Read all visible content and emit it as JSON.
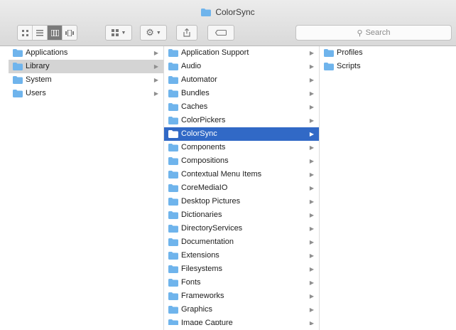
{
  "window": {
    "title": "ColorSync"
  },
  "toolbar": {
    "view_buttons": [
      "icon-view",
      "list-view",
      "column-view",
      "cover-flow-view"
    ],
    "search_placeholder": "Search"
  },
  "columns": [
    {
      "items": [
        {
          "label": "Applications",
          "has_arrow": true,
          "state": ""
        },
        {
          "label": "Library",
          "has_arrow": true,
          "state": "selected-inactive"
        },
        {
          "label": "System",
          "has_arrow": true,
          "state": ""
        },
        {
          "label": "Users",
          "has_arrow": true,
          "state": ""
        }
      ]
    },
    {
      "items": [
        {
          "label": "Application Support",
          "has_arrow": true,
          "state": ""
        },
        {
          "label": "Audio",
          "has_arrow": true,
          "state": ""
        },
        {
          "label": "Automator",
          "has_arrow": true,
          "state": ""
        },
        {
          "label": "Bundles",
          "has_arrow": true,
          "state": ""
        },
        {
          "label": "Caches",
          "has_arrow": true,
          "state": ""
        },
        {
          "label": "ColorPickers",
          "has_arrow": true,
          "state": ""
        },
        {
          "label": "ColorSync",
          "has_arrow": true,
          "state": "selected-active"
        },
        {
          "label": "Components",
          "has_arrow": true,
          "state": ""
        },
        {
          "label": "Compositions",
          "has_arrow": true,
          "state": ""
        },
        {
          "label": "Contextual Menu Items",
          "has_arrow": true,
          "state": ""
        },
        {
          "label": "CoreMediaIO",
          "has_arrow": true,
          "state": ""
        },
        {
          "label": "Desktop Pictures",
          "has_arrow": true,
          "state": ""
        },
        {
          "label": "Dictionaries",
          "has_arrow": true,
          "state": ""
        },
        {
          "label": "DirectoryServices",
          "has_arrow": true,
          "state": ""
        },
        {
          "label": "Documentation",
          "has_arrow": true,
          "state": ""
        },
        {
          "label": "Extensions",
          "has_arrow": true,
          "state": ""
        },
        {
          "label": "Filesystems",
          "has_arrow": true,
          "state": ""
        },
        {
          "label": "Fonts",
          "has_arrow": true,
          "state": ""
        },
        {
          "label": "Frameworks",
          "has_arrow": true,
          "state": ""
        },
        {
          "label": "Graphics",
          "has_arrow": true,
          "state": ""
        },
        {
          "label": "Image Capture",
          "has_arrow": true,
          "state": "partial"
        }
      ]
    },
    {
      "items": [
        {
          "label": "Profiles",
          "has_arrow": false,
          "state": ""
        },
        {
          "label": "Scripts",
          "has_arrow": false,
          "state": "",
          "icon": "scripts-folder-icon"
        }
      ]
    }
  ],
  "colors": {
    "selection": "#3169c6",
    "folder": "#6fb4ec"
  }
}
